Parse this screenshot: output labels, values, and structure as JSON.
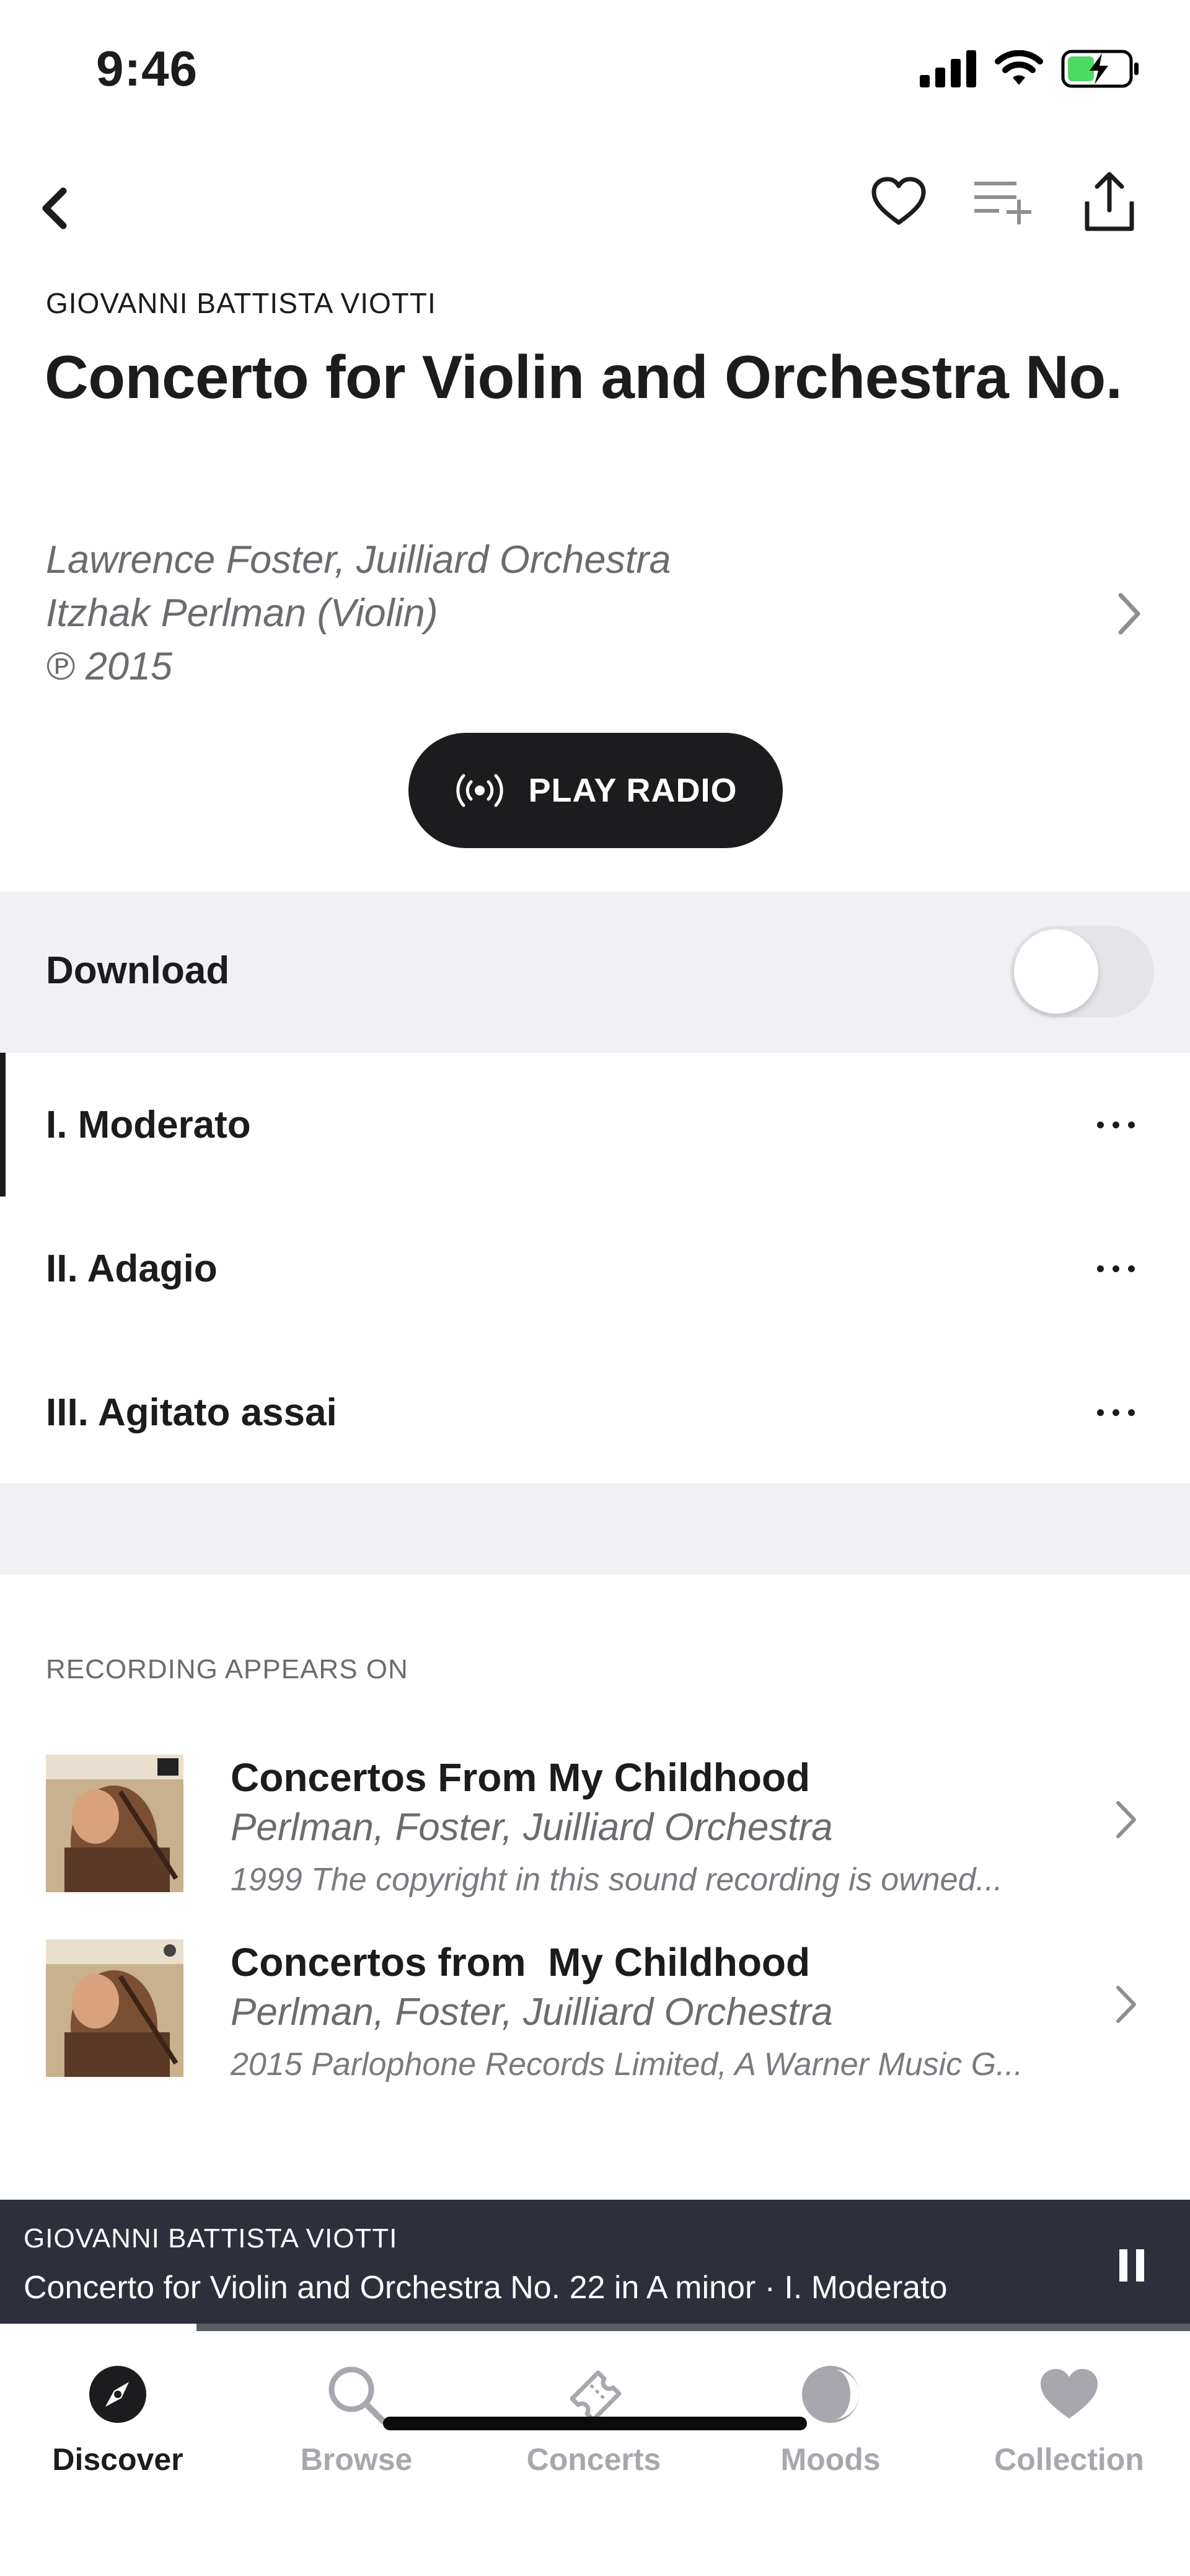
{
  "status_bar": {
    "time": "9:46",
    "icons": [
      "signal-icon",
      "wifi-icon",
      "battery-charging-icon"
    ],
    "battery_color": "#4cd964"
  },
  "nav": {
    "back_icon": "chevron-left-icon",
    "actions": [
      "heart-icon",
      "add-to-queue-icon",
      "share-icon"
    ]
  },
  "header": {
    "composer": "GIOVANNI BATTISTA VIOTTI",
    "title": "Concerto for Violin and Orchestra No.",
    "credits": {
      "line1": "Lawrence Foster, Juilliard Orchestra",
      "line2": "Itzhak Perlman (Violin)",
      "line3": "℗ 2015"
    }
  },
  "play_radio": {
    "label": "PLAY RADIO",
    "icon": "radio-broadcast-icon"
  },
  "download": {
    "label": "Download",
    "enabled": false
  },
  "tracks": [
    {
      "label": "I. Moderato",
      "active": true
    },
    {
      "label": "II. Adagio",
      "active": false
    },
    {
      "label": "III. Agitato assai",
      "active": false
    }
  ],
  "appears_on": {
    "section_label": "RECORDING APPEARS ON",
    "albums": [
      {
        "title": "Concertos From My Childhood",
        "artists": "Perlman, Foster, Juilliard Orchestra",
        "copyright": "1999 The copyright in this sound recording is owned..."
      },
      {
        "title": "Concertos from  My Childhood",
        "artists": "Perlman, Foster, Juilliard Orchestra",
        "copyright": "2015 Parlophone Records Limited, A Warner Music G..."
      }
    ]
  },
  "now_playing": {
    "composer": "GIOVANNI BATTISTA VIOTTI",
    "title": "Concerto for Violin and Orchestra No. 22 in A minor  ·  I. Moderato",
    "progress": 0.165,
    "pause_icon": "pause-icon"
  },
  "tabs": [
    {
      "label": "Discover",
      "icon": "compass-icon",
      "active": true
    },
    {
      "label": "Browse",
      "icon": "search-icon",
      "active": false
    },
    {
      "label": "Concerts",
      "icon": "ticket-icon",
      "active": false
    },
    {
      "label": "Moods",
      "icon": "moon-icon",
      "active": false
    },
    {
      "label": "Collection",
      "icon": "heart-icon",
      "active": false
    }
  ]
}
